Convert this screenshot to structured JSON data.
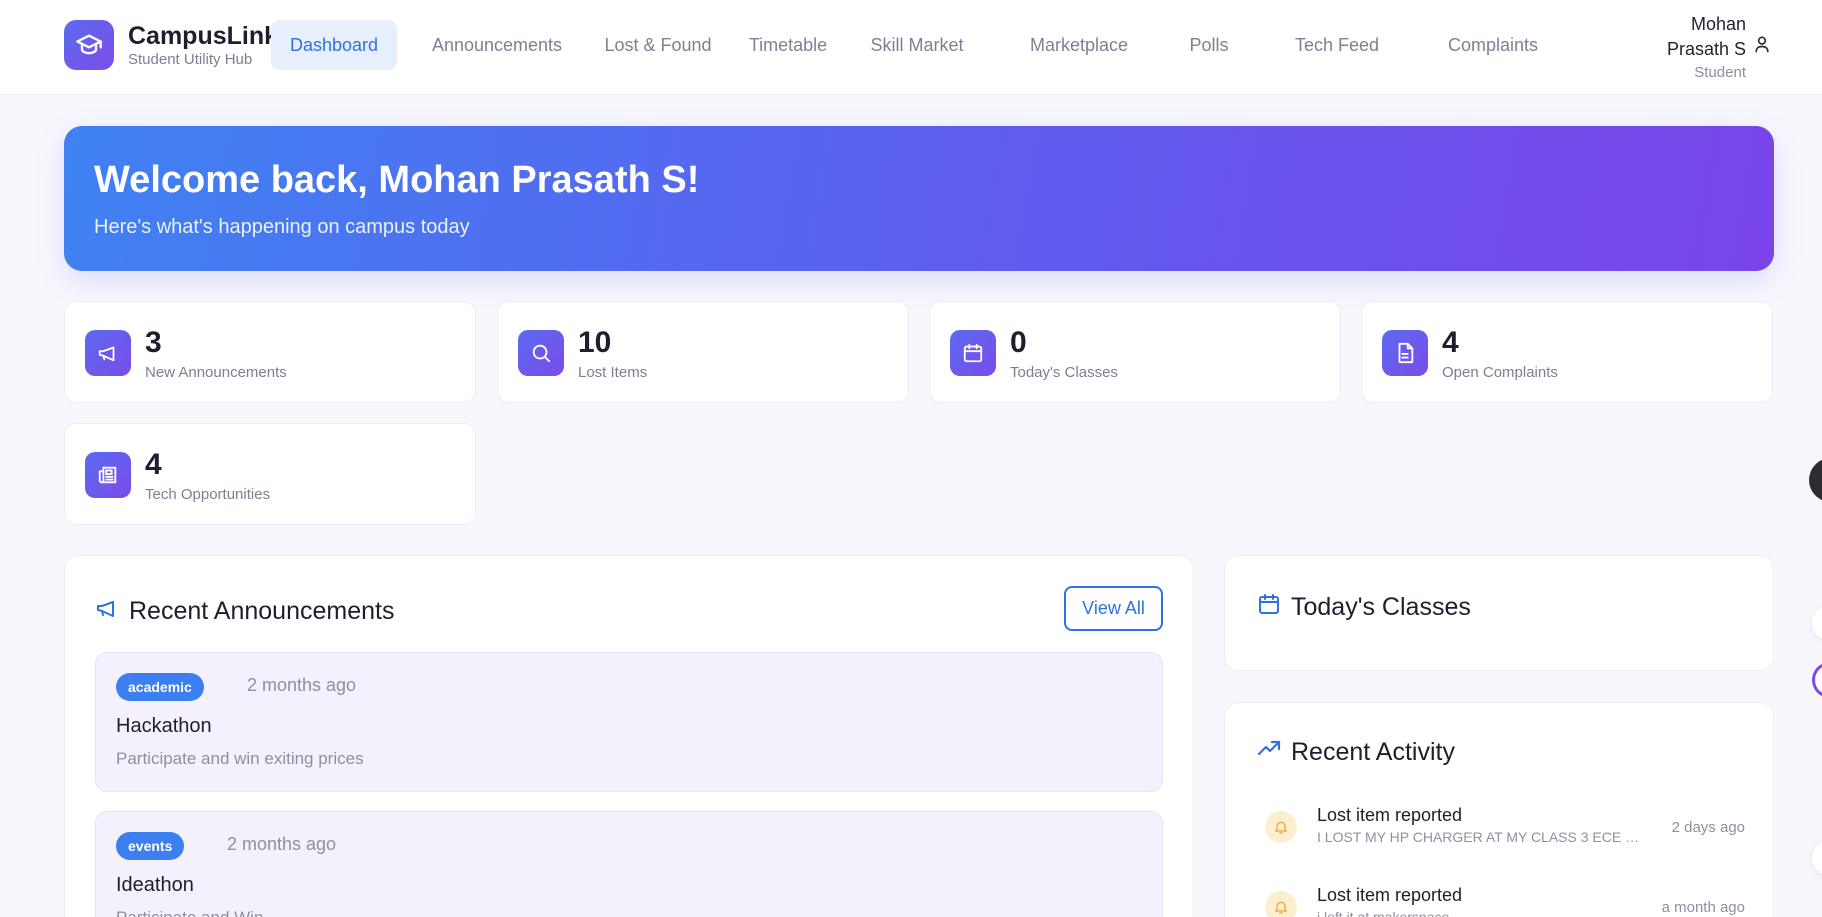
{
  "app": {
    "name": "CampusLink",
    "subtitle": "Student Utility Hub"
  },
  "nav": {
    "items": [
      {
        "label": "Dashboard",
        "active": true
      },
      {
        "label": "Announcements"
      },
      {
        "label": "Lost & Found"
      },
      {
        "label": "Timetable"
      },
      {
        "label": "Skill Market"
      },
      {
        "label": "Marketplace"
      },
      {
        "label": "Polls"
      },
      {
        "label": "Tech Feed"
      },
      {
        "label": "Complaints"
      }
    ]
  },
  "user": {
    "name_line1": "Mohan",
    "name_line2": "Prasath S",
    "role": "Student",
    "icon": "user-icon"
  },
  "hero": {
    "title": "Welcome back, Mohan Prasath S!",
    "subtitle": "Here's what's happening on campus today"
  },
  "stats": [
    {
      "value": "3",
      "label": "New Announcements",
      "icon": "megaphone-icon"
    },
    {
      "value": "10",
      "label": "Lost Items",
      "icon": "search-icon"
    },
    {
      "value": "0",
      "label": "Today's Classes",
      "icon": "calendar-icon"
    },
    {
      "value": "4",
      "label": "Open Complaints",
      "icon": "document-icon"
    },
    {
      "value": "4",
      "label": "Tech Opportunities",
      "icon": "newspaper-icon"
    }
  ],
  "announcements": {
    "title": "Recent Announcements",
    "view_all": "View All",
    "items": [
      {
        "tag": "academic",
        "time": "2 months ago",
        "title": "Hackathon",
        "desc": "Participate and win exiting prices"
      },
      {
        "tag": "events",
        "time": "2 months ago",
        "title": "Ideathon",
        "desc": "Participate and Win"
      }
    ]
  },
  "classes": {
    "title": "Today's Classes"
  },
  "activity": {
    "title": "Recent Activity",
    "items": [
      {
        "title": "Lost item reported",
        "desc": "I LOST MY HP CHARGER AT MY CLASS 3 ECE C I...",
        "time": "2 days ago",
        "icon": "bell-icon"
      },
      {
        "title": "Lost item reported",
        "desc": "i left it at makerspace",
        "time": "a month ago",
        "icon": "bell-icon"
      }
    ]
  },
  "colors": {
    "accent": "#2f72df",
    "gradient_start": "#3f82f2",
    "gradient_end": "#7a44ea",
    "icon_gradient_start": "#5a6cf2",
    "icon_gradient_end": "#7b4ae8",
    "activity_icon_bg": "#fdeecf"
  }
}
